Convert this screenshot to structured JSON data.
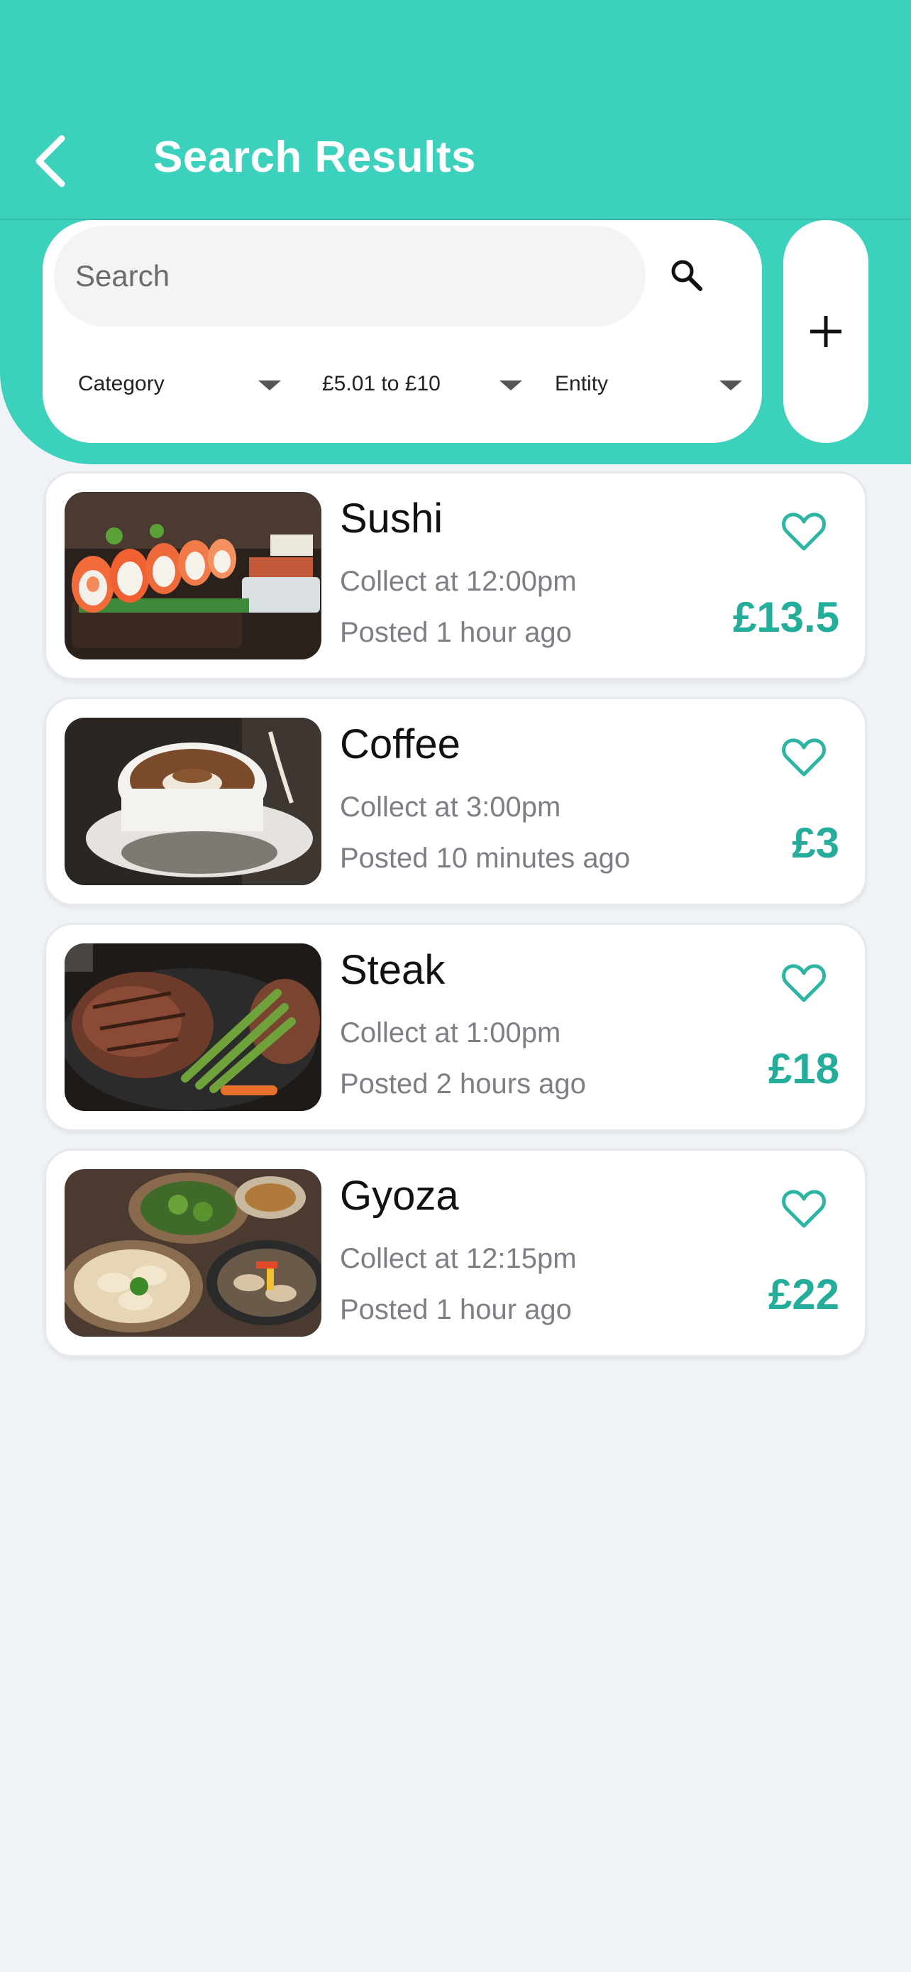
{
  "header": {
    "title": "Search Results",
    "back_icon": "chevron-left-icon",
    "background": "#3bd1bd"
  },
  "search": {
    "placeholder": "Search",
    "value": "",
    "icon": "search-icon"
  },
  "filters": [
    {
      "label": "Category"
    },
    {
      "label": "£5.01 to £10"
    },
    {
      "label": "Entity"
    }
  ],
  "add_button": {
    "icon": "plus-icon"
  },
  "colors": {
    "accent": "#3bd1bd",
    "price": "#24ad9b",
    "muted_text": "#7e7e86"
  },
  "results": [
    {
      "title": "Sushi",
      "collect": "Collect at 12:00pm",
      "posted": "Posted 1 hour ago",
      "price": "£13.5",
      "image": "sushi-image"
    },
    {
      "title": "Coffee",
      "collect": "Collect at 3:00pm",
      "posted": "Posted 10 minutes ago",
      "price": "£3",
      "image": "coffee-image"
    },
    {
      "title": "Steak",
      "collect": "Collect at 1:00pm",
      "posted": "Posted 2 hours ago",
      "price": "£18",
      "image": "steak-image"
    },
    {
      "title": "Gyoza",
      "collect": "Collect at 12:15pm",
      "posted": "Posted 1 hour ago",
      "price": "£22",
      "image": "gyoza-image"
    }
  ]
}
